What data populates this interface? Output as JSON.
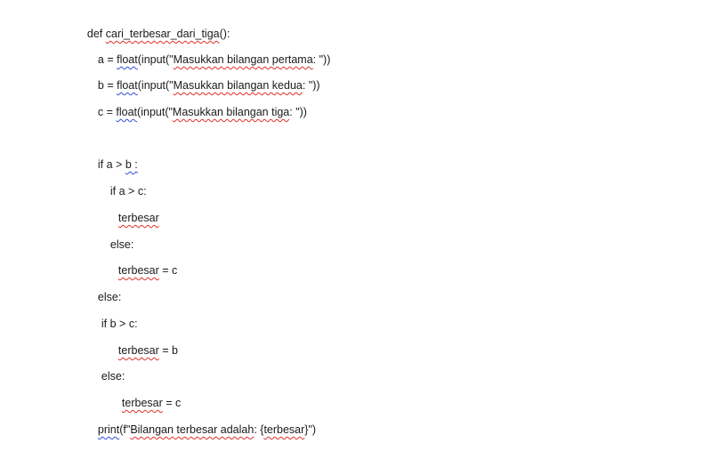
{
  "document": {
    "lines": [
      {
        "parts": [
          {
            "t": "def ",
            "m": ""
          },
          {
            "t": "cari_terbesar_dari_tiga",
            "m": "sp"
          },
          {
            "t": "():",
            "m": ""
          }
        ]
      },
      {
        "parts": [
          {
            "t": "a = ",
            "m": ""
          },
          {
            "t": "float",
            "m": "gr"
          },
          {
            "t": "(input(\"",
            "m": ""
          },
          {
            "t": "Masukkan bilangan pertama",
            "m": "sp"
          },
          {
            "t": ": \"))",
            "m": ""
          }
        ]
      },
      {
        "parts": [
          {
            "t": "b = ",
            "m": ""
          },
          {
            "t": "float",
            "m": "gr"
          },
          {
            "t": "(input(\"",
            "m": ""
          },
          {
            "t": "Masukkan bilangan kedua",
            "m": "sp"
          },
          {
            "t": ": \"))",
            "m": ""
          }
        ]
      },
      {
        "parts": [
          {
            "t": "c = ",
            "m": ""
          },
          {
            "t": "float",
            "m": "gr"
          },
          {
            "t": "(input(\"",
            "m": ""
          },
          {
            "t": "Masukkan bilangan tiga",
            "m": "sp"
          },
          {
            "t": ": \"))",
            "m": ""
          }
        ]
      },
      {
        "parts": [
          {
            "t": "if a > ",
            "m": ""
          },
          {
            "t": "b :",
            "m": "gr"
          }
        ]
      },
      {
        "parts": [
          {
            "t": "if a > c:",
            "m": ""
          }
        ]
      },
      {
        "parts": [
          {
            "t": "terbesar",
            "m": "sp"
          }
        ]
      },
      {
        "parts": [
          {
            "t": "else:",
            "m": ""
          }
        ]
      },
      {
        "parts": [
          {
            "t": "terbesar",
            "m": "sp"
          },
          {
            "t": " = c",
            "m": ""
          }
        ]
      },
      {
        "parts": [
          {
            "t": "else:",
            "m": ""
          }
        ]
      },
      {
        "parts": [
          {
            "t": "if b > c:",
            "m": ""
          }
        ]
      },
      {
        "parts": [
          {
            "t": "terbesar",
            "m": "sp"
          },
          {
            "t": " = b",
            "m": ""
          }
        ]
      },
      {
        "parts": [
          {
            "t": "else:",
            "m": ""
          }
        ]
      },
      {
        "parts": [
          {
            "t": "terbesar",
            "m": "sp"
          },
          {
            "t": " = c",
            "m": ""
          }
        ]
      },
      {
        "parts": [
          {
            "t": "print",
            "m": "gr"
          },
          {
            "t": "(f\"",
            "m": ""
          },
          {
            "t": "Bilangan terbesar adalah",
            "m": "sp"
          },
          {
            "t": ": {",
            "m": ""
          },
          {
            "t": "terbesar",
            "m": "sp"
          },
          {
            "t": "}\")",
            "m": ""
          }
        ]
      }
    ]
  },
  "colors": {
    "text": "#1a1a1a",
    "spelling_underline": "#e0302a",
    "grammar_underline": "#2f4fd8",
    "background": "#ffffff"
  }
}
